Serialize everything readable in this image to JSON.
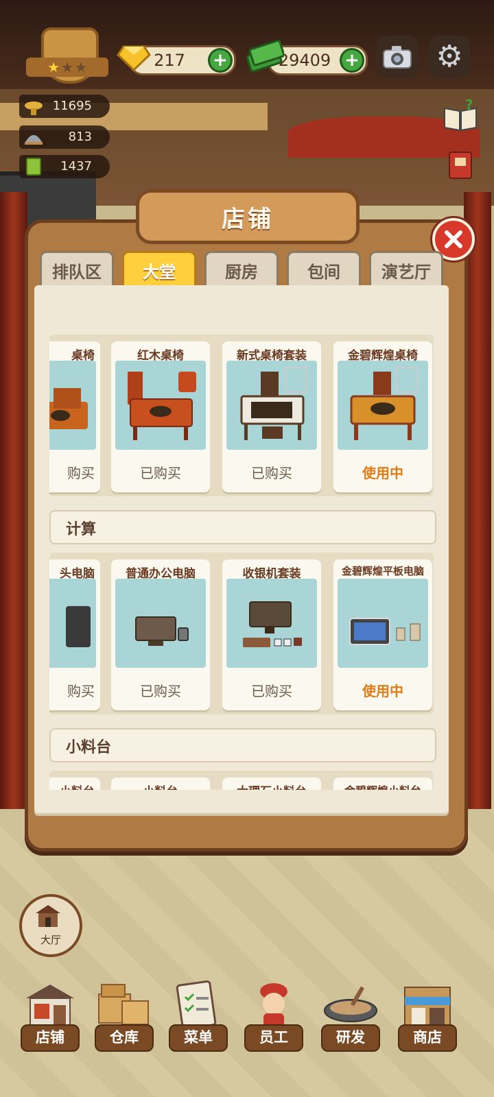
{
  "hud": {
    "gems": "217",
    "cash": "29409",
    "stars_filled": 1,
    "stars_total": 3,
    "stats": [
      {
        "icon": "pot-icon",
        "value": "11695"
      },
      {
        "icon": "dish-cover-icon",
        "value": "813"
      },
      {
        "icon": "menu-book-icon",
        "value": "1437"
      }
    ]
  },
  "dialog": {
    "title": "店铺",
    "tabs": [
      {
        "label": "排队区",
        "active": false
      },
      {
        "label": "大堂",
        "active": true
      },
      {
        "label": "厨房",
        "active": false
      },
      {
        "label": "包间",
        "active": false
      },
      {
        "label": "演艺厅",
        "active": false
      }
    ],
    "sections": [
      {
        "name": "",
        "items": [
          {
            "name": "桌椅",
            "status": "购买",
            "using": false
          },
          {
            "name": "红木桌椅",
            "status": "已购买",
            "using": false
          },
          {
            "name": "新式桌椅套装",
            "status": "已购买",
            "using": false
          },
          {
            "name": "金碧辉煌桌椅",
            "status": "使用中",
            "using": true
          }
        ]
      },
      {
        "name": "计算",
        "items": [
          {
            "name": "头电脑",
            "status": "购买",
            "using": false
          },
          {
            "name": "普通办公电脑",
            "status": "已购买",
            "using": false
          },
          {
            "name": "收银机套装",
            "status": "已购买",
            "using": false
          },
          {
            "name": "金碧辉煌平板电脑",
            "status": "使用中",
            "using": true
          }
        ]
      },
      {
        "name": "小料台",
        "items": [
          {
            "name": "小料台",
            "status": "",
            "using": false
          },
          {
            "name": "小料台",
            "status": "",
            "using": false
          },
          {
            "name": "大理石小料台",
            "status": "",
            "using": false
          },
          {
            "name": "金碧辉煌小料台",
            "status": "",
            "using": false
          }
        ]
      }
    ]
  },
  "hall_button": "大厅",
  "nav": [
    {
      "label": "店铺",
      "icon": "shop-building-icon"
    },
    {
      "label": "仓库",
      "icon": "warehouse-boxes-icon"
    },
    {
      "label": "菜单",
      "icon": "clipboard-menu-icon"
    },
    {
      "label": "员工",
      "icon": "staff-chef-icon"
    },
    {
      "label": "研发",
      "icon": "wok-icon"
    },
    {
      "label": "商店",
      "icon": "store-front-icon"
    }
  ],
  "colors": {
    "active_tab": "#ffcf3d",
    "using_text": "#e37a14",
    "close_button": "#d8392a",
    "plus_button": "#46a640"
  }
}
